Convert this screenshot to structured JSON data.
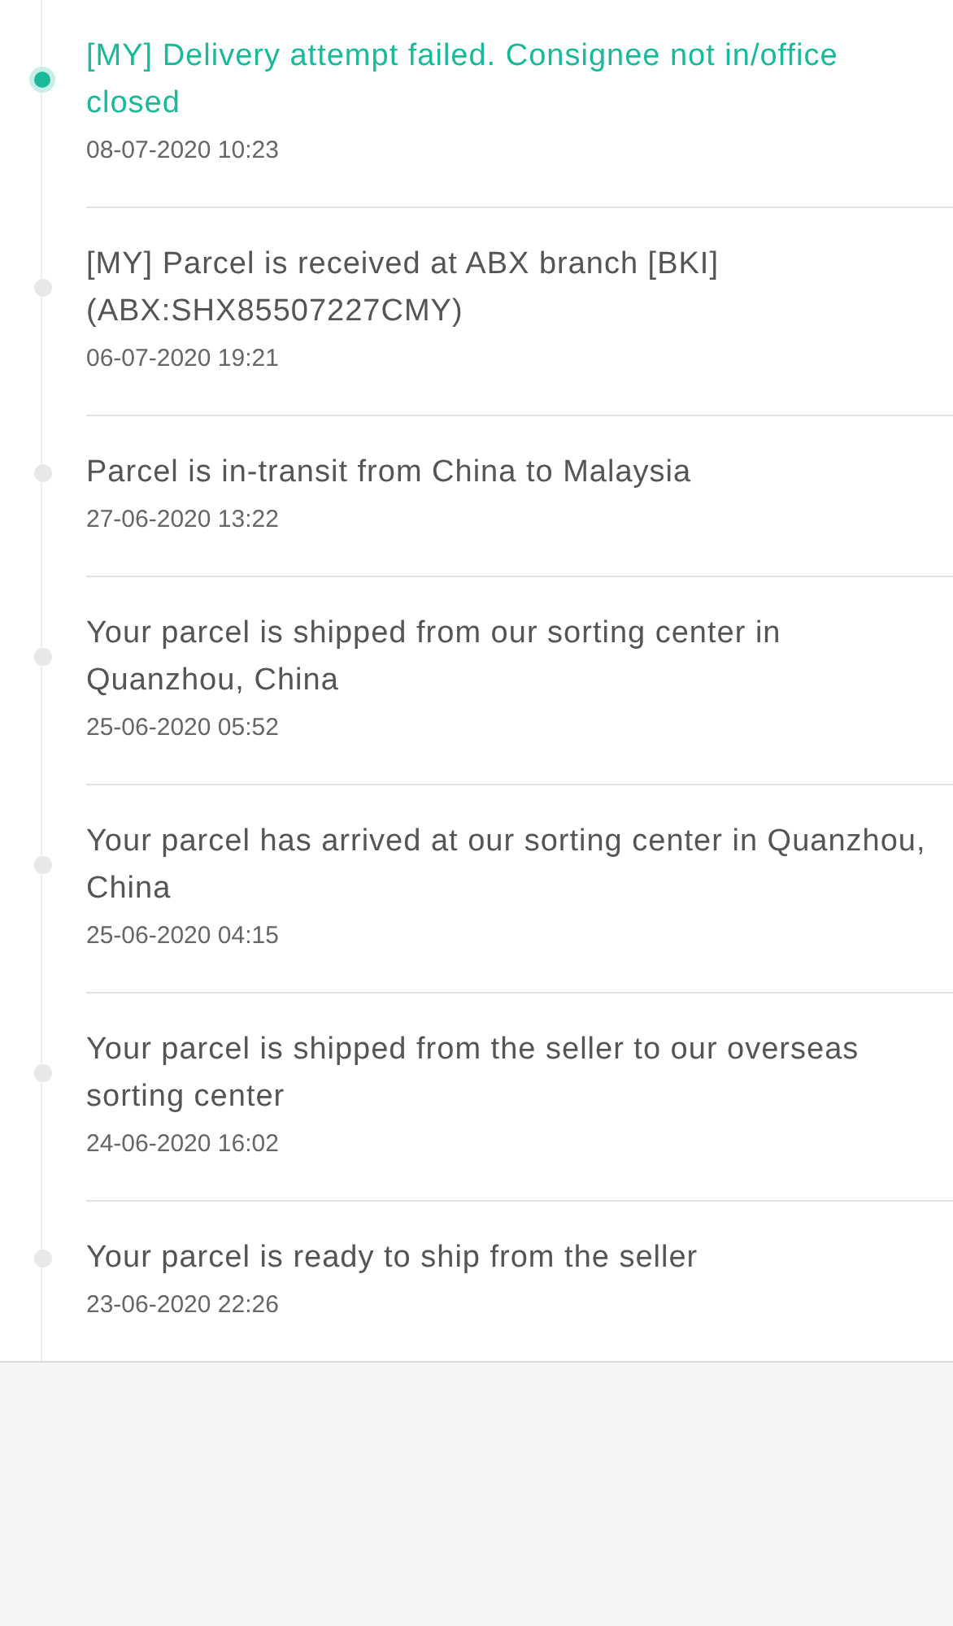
{
  "events": [
    {
      "text": "[MY] Delivery attempt failed. Consignee not in/office closed",
      "time": "08-07-2020 10:23",
      "selected": true
    },
    {
      "text": "[MY] Parcel is received at ABX branch [BKI] (ABX:SHX85507227CMY)",
      "time": "06-07-2020 19:21",
      "selected": false
    },
    {
      "text": "Parcel is in-transit from China to Malaysia",
      "time": "27-06-2020 13:22",
      "selected": false
    },
    {
      "text": "Your parcel is shipped from our sorting center in Quanzhou, China",
      "time": "25-06-2020 05:52",
      "selected": false
    },
    {
      "text": "Your parcel has arrived at our sorting center in Quanzhou, China",
      "time": "25-06-2020 04:15",
      "selected": false
    },
    {
      "text": "Your parcel is shipped from the seller to our overseas sorting center",
      "time": "24-06-2020 16:02",
      "selected": false
    },
    {
      "text": "Your parcel is ready to ship from the seller",
      "time": "23-06-2020 22:26",
      "selected": false
    }
  ]
}
